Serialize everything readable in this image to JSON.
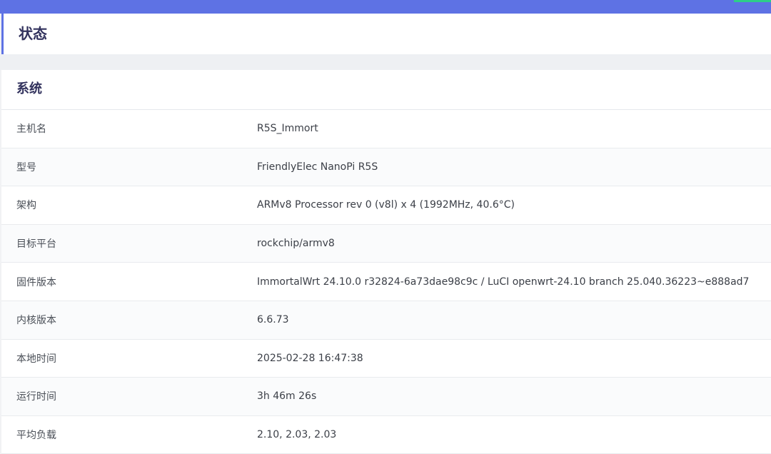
{
  "colors": {
    "topbar": "#5e72e4",
    "accent": "#2dce89",
    "title_text": "#32325d"
  },
  "page": {
    "title": "状态"
  },
  "section": {
    "title": "系统",
    "rows": [
      {
        "label": "主机名",
        "value": "R5S_Immort"
      },
      {
        "label": "型号",
        "value": "FriendlyElec NanoPi R5S"
      },
      {
        "label": "架构",
        "value": "ARMv8 Processor rev 0 (v8l) x 4 (1992MHz, 40.6°C)"
      },
      {
        "label": "目标平台",
        "value": "rockchip/armv8"
      },
      {
        "label": "固件版本",
        "value": "ImmortalWrt 24.10.0 r32824-6a73dae98c9c / LuCI openwrt-24.10 branch 25.040.36223~e888ad7"
      },
      {
        "label": "内核版本",
        "value": "6.6.73"
      },
      {
        "label": "本地时间",
        "value": "2025-02-28 16:47:38"
      },
      {
        "label": "运行时间",
        "value": "3h 46m 26s"
      },
      {
        "label": "平均负载",
        "value": "2.10, 2.03, 2.03"
      }
    ]
  }
}
